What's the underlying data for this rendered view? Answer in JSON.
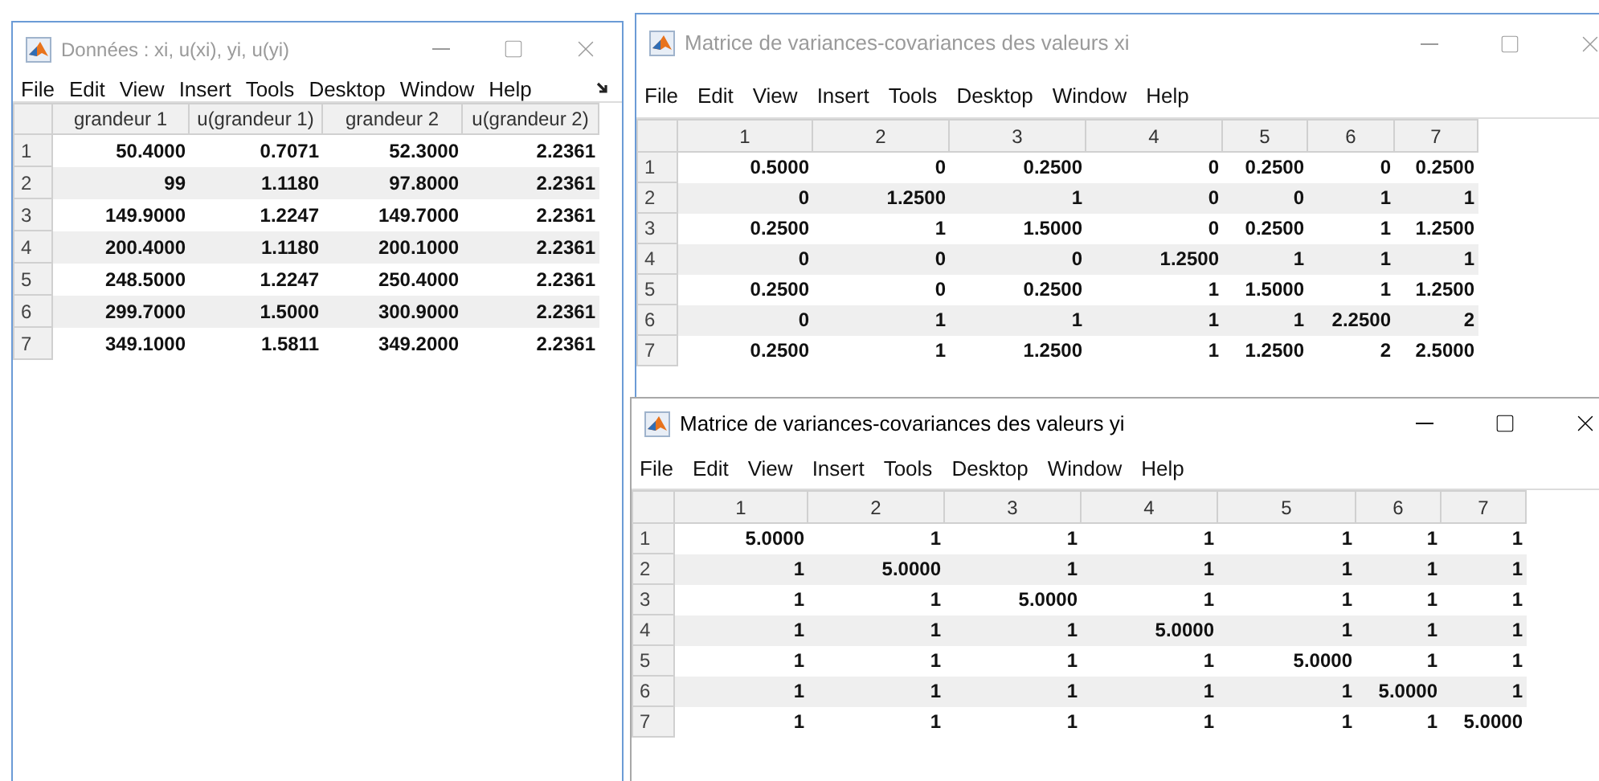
{
  "windows": [
    {
      "title": "Données : xi, u(xi), yi, u(yi)",
      "active": false,
      "menu": [
        "File",
        "Edit",
        "View",
        "Insert",
        "Tools",
        "Desktop",
        "Window",
        "Help"
      ],
      "menu_overflow": true,
      "table": {
        "columns": [
          "grandeur 1",
          "u(grandeur 1)",
          "grandeur 2",
          "u(grandeur 2)"
        ],
        "rows": [
          {
            "header": "1",
            "cells": [
              "50.4000",
              "0.7071",
              "52.3000",
              "2.2361"
            ]
          },
          {
            "header": "2",
            "cells": [
              "99",
              "1.1180",
              "97.8000",
              "2.2361"
            ]
          },
          {
            "header": "3",
            "cells": [
              "149.9000",
              "1.2247",
              "149.7000",
              "2.2361"
            ]
          },
          {
            "header": "4",
            "cells": [
              "200.4000",
              "1.1180",
              "200.1000",
              "2.2361"
            ]
          },
          {
            "header": "5",
            "cells": [
              "248.5000",
              "1.2247",
              "250.4000",
              "2.2361"
            ]
          },
          {
            "header": "6",
            "cells": [
              "299.7000",
              "1.5000",
              "300.9000",
              "2.2361"
            ]
          },
          {
            "header": "7",
            "cells": [
              "349.1000",
              "1.5811",
              "349.2000",
              "2.2361"
            ]
          }
        ]
      }
    },
    {
      "title": "Matrice de variances-covariances des valeurs xi",
      "active": false,
      "menu": [
        "File",
        "Edit",
        "View",
        "Insert",
        "Tools",
        "Desktop",
        "Window",
        "Help"
      ],
      "table": {
        "columns": [
          "1",
          "2",
          "3",
          "4",
          "5",
          "6",
          "7"
        ],
        "rows": [
          {
            "header": "1",
            "cells": [
              "0.5000",
              "0",
              "0.2500",
              "0",
              "0.2500",
              "0",
              "0.2500"
            ]
          },
          {
            "header": "2",
            "cells": [
              "0",
              "1.2500",
              "1",
              "0",
              "0",
              "1",
              "1"
            ]
          },
          {
            "header": "3",
            "cells": [
              "0.2500",
              "1",
              "1.5000",
              "0",
              "0.2500",
              "1",
              "1.2500"
            ]
          },
          {
            "header": "4",
            "cells": [
              "0",
              "0",
              "0",
              "1.2500",
              "1",
              "1",
              "1"
            ]
          },
          {
            "header": "5",
            "cells": [
              "0.2500",
              "0",
              "0.2500",
              "1",
              "1.5000",
              "1",
              "1.2500"
            ]
          },
          {
            "header": "6",
            "cells": [
              "0",
              "1",
              "1",
              "1",
              "1",
              "2.2500",
              "2"
            ]
          },
          {
            "header": "7",
            "cells": [
              "0.2500",
              "1",
              "1.2500",
              "1",
              "1.2500",
              "2",
              "2.5000"
            ]
          }
        ]
      }
    },
    {
      "title": "Matrice de variances-covariances des valeurs yi",
      "active": true,
      "menu": [
        "File",
        "Edit",
        "View",
        "Insert",
        "Tools",
        "Desktop",
        "Window",
        "Help"
      ],
      "table": {
        "columns": [
          "1",
          "2",
          "3",
          "4",
          "5",
          "6",
          "7"
        ],
        "rows": [
          {
            "header": "1",
            "cells": [
              "5.0000",
              "1",
              "1",
              "1",
              "1",
              "1",
              "1"
            ]
          },
          {
            "header": "2",
            "cells": [
              "1",
              "5.0000",
              "1",
              "1",
              "1",
              "1",
              "1"
            ]
          },
          {
            "header": "3",
            "cells": [
              "1",
              "1",
              "5.0000",
              "1",
              "1",
              "1",
              "1"
            ]
          },
          {
            "header": "4",
            "cells": [
              "1",
              "1",
              "1",
              "5.0000",
              "1",
              "1",
              "1"
            ]
          },
          {
            "header": "5",
            "cells": [
              "1",
              "1",
              "1",
              "1",
              "5.0000",
              "1",
              "1"
            ]
          },
          {
            "header": "6",
            "cells": [
              "1",
              "1",
              "1",
              "1",
              "1",
              "5.0000",
              "1"
            ]
          },
          {
            "header": "7",
            "cells": [
              "1",
              "1",
              "1",
              "1",
              "1",
              "1",
              "5.0000"
            ]
          }
        ]
      }
    }
  ]
}
